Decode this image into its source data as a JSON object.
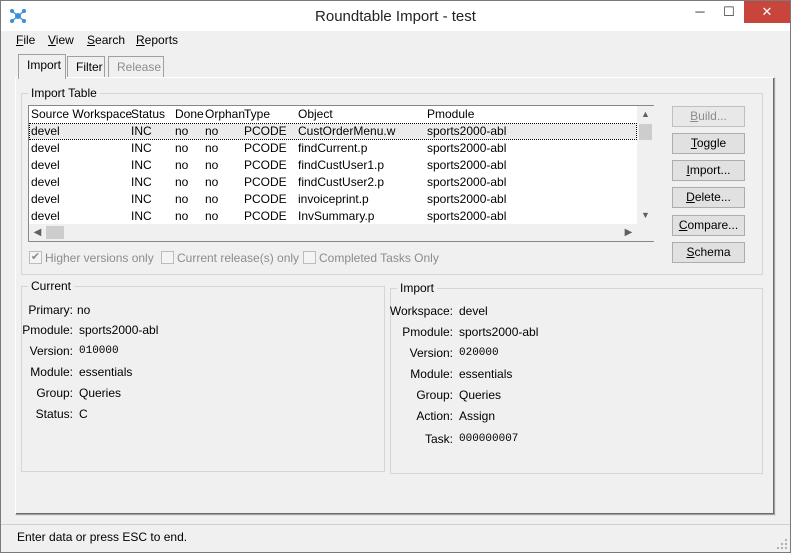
{
  "window": {
    "title": "Roundtable Import - test",
    "minimize": "─",
    "maximize": "☐",
    "close": "✕"
  },
  "menu": [
    {
      "label": "File",
      "u": "F",
      "rest": "ile"
    },
    {
      "label": "View",
      "u": "V",
      "rest": "iew"
    },
    {
      "label": "Search",
      "u": "S",
      "rest": "earch"
    },
    {
      "label": "Reports",
      "u": "R",
      "rest": "eports"
    }
  ],
  "tabs": {
    "import": "Import",
    "filter": "Filter",
    "release": "Release"
  },
  "import_table": {
    "legend": "Import Table",
    "columns": [
      "Source Workspace",
      "Status",
      "Done",
      "Orphan",
      "Type",
      "Object",
      "Pmodule"
    ],
    "rows": [
      [
        "devel",
        "INC",
        "no",
        "no",
        "PCODE",
        "CustOrderMenu.w",
        "sports2000-abl"
      ],
      [
        "devel",
        "INC",
        "no",
        "no",
        "PCODE",
        "findCurrent.p",
        "sports2000-abl"
      ],
      [
        "devel",
        "INC",
        "no",
        "no",
        "PCODE",
        "findCustUser1.p",
        "sports2000-abl"
      ],
      [
        "devel",
        "INC",
        "no",
        "no",
        "PCODE",
        "findCustUser2.p",
        "sports2000-abl"
      ],
      [
        "devel",
        "INC",
        "no",
        "no",
        "PCODE",
        "invoiceprint.p",
        "sports2000-abl"
      ],
      [
        "devel",
        "INC",
        "no",
        "no",
        "PCODE",
        "InvSummary.p",
        "sports2000-abl"
      ]
    ]
  },
  "buttons": {
    "build": {
      "u": "B",
      "rest": "uild..."
    },
    "toggle": {
      "u": "T",
      "rest": "oggle"
    },
    "import": {
      "u": "I",
      "rest": "mport..."
    },
    "delete": {
      "u": "D",
      "rest": "elete..."
    },
    "compare": {
      "u": "C",
      "rest": "ompare..."
    },
    "schema": {
      "u": "S",
      "rest": "chema"
    }
  },
  "checks": {
    "higher_versions": {
      "label": "Higher versions only",
      "checked": true
    },
    "current_release": {
      "label": "Current release(s) only",
      "checked": false
    },
    "completed_tasks": {
      "label": "Completed Tasks Only",
      "checked": false
    }
  },
  "current": {
    "legend": "Current",
    "primary_label": "Primary:",
    "primary": "no",
    "pmodule_label": "Pmodule:",
    "pmodule": "sports2000-abl",
    "version_label": "Version:",
    "version": "010000",
    "module_label": "Module:",
    "module": "essentials",
    "group_label": "Group:",
    "group": "Queries",
    "status_label": "Status:",
    "status": "C"
  },
  "import": {
    "legend": "Import",
    "workspace_label": "Workspace:",
    "workspace": "devel",
    "pmodule_label": "Pmodule:",
    "pmodule": "sports2000-abl",
    "version_label": "Version:",
    "version": "020000",
    "module_label": "Module:",
    "module": "essentials",
    "group_label": "Group:",
    "group": "Queries",
    "action_label": "Action:",
    "action": "Assign",
    "task_label": "Task:",
    "task": "000000007"
  },
  "status_bar": {
    "text": "Enter data or press ESC to end."
  }
}
